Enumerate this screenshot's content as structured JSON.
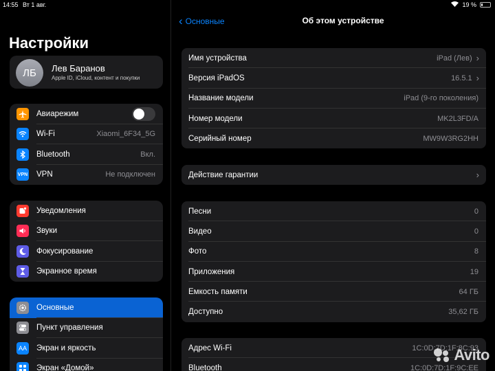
{
  "status": {
    "time": "14:55",
    "date": "Вт 1 авг.",
    "battery": "19 %",
    "battery_level": 0.19
  },
  "sidebar": {
    "title": "Настройки",
    "profile": {
      "initials": "ЛБ",
      "name": "Лев Баранов",
      "subtitle": "Apple ID, iCloud, контент и покупки"
    },
    "group1": [
      {
        "label": "Авиарежим",
        "value": "",
        "icon": "airplane-icon",
        "color": "#ff9500",
        "toggle": false
      },
      {
        "label": "Wi-Fi",
        "value": "Xiaomi_6F34_5G",
        "icon": "wifi-icon",
        "color": "#0a84ff"
      },
      {
        "label": "Bluetooth",
        "value": "Вкл.",
        "icon": "bluetooth-icon",
        "color": "#0a84ff"
      },
      {
        "label": "VPN",
        "value": "Не подключен",
        "icon": "vpn-icon",
        "color": "#0a84ff"
      }
    ],
    "group2": [
      {
        "label": "Уведомления",
        "icon": "bell-icon",
        "color": "#ff3b30"
      },
      {
        "label": "Звуки",
        "icon": "speaker-icon",
        "color": "#ff2d55"
      },
      {
        "label": "Фокусирование",
        "icon": "moon-icon",
        "color": "#5e5ce6"
      },
      {
        "label": "Экранное время",
        "icon": "hourglass-icon",
        "color": "#5e5ce6"
      }
    ],
    "group3": [
      {
        "label": "Основные",
        "icon": "gear-icon",
        "color": "#8e8e93",
        "selected": true
      },
      {
        "label": "Пункт управления",
        "icon": "switches-icon",
        "color": "#8e8e93"
      },
      {
        "label": "Экран и яркость",
        "icon": "aa-icon",
        "color": "#0a84ff"
      },
      {
        "label": "Экран «Домой»",
        "icon": "grid-icon",
        "color": "#0a84ff"
      }
    ]
  },
  "detail": {
    "back_label": "Основные",
    "title": "Об этом устройстве",
    "group1": [
      {
        "label": "Имя устройства",
        "value": "iPad (Лев)",
        "chevron": true
      },
      {
        "label": "Версия iPadOS",
        "value": "16.5.1",
        "chevron": true
      },
      {
        "label": "Название модели",
        "value": "iPad (9-го поколения)"
      },
      {
        "label": "Номер модели",
        "value": "MK2L3FD/A"
      },
      {
        "label": "Серийный номер",
        "value": "MW9W3RG2HH"
      }
    ],
    "group2": [
      {
        "label": "Действие гарантии",
        "value": "",
        "chevron": true
      }
    ],
    "group3": [
      {
        "label": "Песни",
        "value": "0"
      },
      {
        "label": "Видео",
        "value": "0"
      },
      {
        "label": "Фото",
        "value": "8"
      },
      {
        "label": "Приложения",
        "value": "19"
      },
      {
        "label": "Емкость памяти",
        "value": "64 ГБ"
      },
      {
        "label": "Доступно",
        "value": "35,62 ГБ"
      }
    ],
    "group4": [
      {
        "label": "Адрес Wi-Fi",
        "value": "1C:0D:7D:1F:8C:93"
      },
      {
        "label": "Bluetooth",
        "value": "1C:0D:7D:1F:9C:EE"
      }
    ]
  },
  "watermark": "Avito"
}
